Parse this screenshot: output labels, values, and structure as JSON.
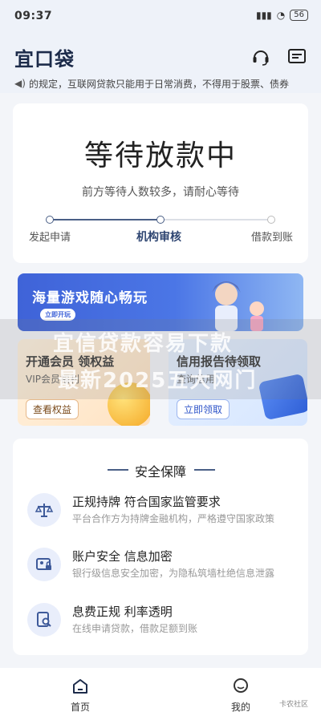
{
  "statusbar": {
    "time": "09:37",
    "battery": "56"
  },
  "header": {
    "logo": "宜口袋"
  },
  "notice": {
    "text": "的规定，互联网贷款只能用于日常消费，不得用于股票、债券"
  },
  "status_card": {
    "title": "等待放款中",
    "subtitle": "前方等待人数较多，请耐心等待",
    "steps": [
      "发起申请",
      "机构审核",
      "借款到账"
    ]
  },
  "game_banner": {
    "title": "海量游戏随心畅玩",
    "button": "立即开玩"
  },
  "vip_card": {
    "title": "开通会员 领权益",
    "subtitle": "VIP会员福利",
    "button": "查看权益"
  },
  "credit_card": {
    "title": "信用报告待领取",
    "subtitle": "查询信用",
    "button": "立即领取"
  },
  "watermark": {
    "line1": "宜信贷款容易下款",
    "line2": "最新2025五大网门"
  },
  "security": {
    "heading": "安全保障",
    "items": [
      {
        "title": "正规持牌 符合国家监管要求",
        "desc": "平台合作方为持牌金融机构，严格遵守国家政策"
      },
      {
        "title": "账户安全 信息加密",
        "desc": "银行级信息安全加密，为隐私筑墙杜绝信息泄露"
      },
      {
        "title": "息费正规  利率透明",
        "desc": "在线申请贷款，借款足额到账"
      }
    ]
  },
  "tabbar": {
    "home": "首页",
    "mine": "我的",
    "corner": "卡农社区"
  }
}
